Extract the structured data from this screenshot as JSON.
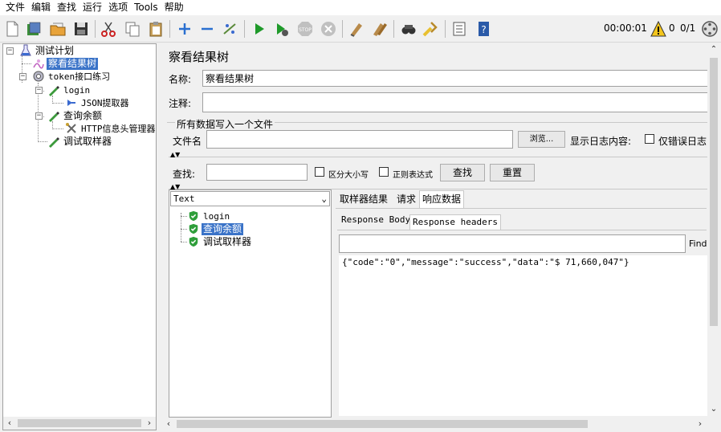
{
  "menu": [
    "文件",
    "编辑",
    "查找",
    "运行",
    "选项",
    "Tools",
    "帮助"
  ],
  "toolbar": {
    "timer": "00:00:01",
    "warnings": "0",
    "threads": "0/1",
    "icons": [
      "new-icon",
      "templates-icon",
      "open-icon",
      "save-icon",
      "cut-icon",
      "copy-icon",
      "paste-icon",
      "expand-icon",
      "collapse-icon",
      "toggle-icon",
      "start-icon",
      "start-no-pause-icon",
      "stop-icon",
      "shutdown-icon",
      "clear-icon",
      "clear-all-icon",
      "search-icon",
      "reset-search-icon",
      "function-helper-icon",
      "help-icon"
    ]
  },
  "tree": {
    "items": [
      {
        "label": "测试计划"
      },
      {
        "label": "察看结果树"
      },
      {
        "label": "token接口练习"
      },
      {
        "label": "login"
      },
      {
        "label": "JSON提取器"
      },
      {
        "label": "查询余额"
      },
      {
        "label": "HTTP信息头管理器"
      },
      {
        "label": "调试取样器"
      }
    ]
  },
  "panel": {
    "title": "察看结果树",
    "name_label": "名称:",
    "name_value": "察看结果树",
    "comment_label": "注释:",
    "comment_value": "",
    "file_group_label": "所有数据写入一个文件",
    "filename_label": "文件名",
    "filename_value": "",
    "browse_button": "浏览...",
    "log_display_label": "显示日志内容:",
    "errors_only_label": "仅错误日志"
  },
  "search": {
    "label": "查找:",
    "value": "",
    "case_sensitive": "区分大小写",
    "regex": "正则表达式",
    "search_button": "查找",
    "reset_button": "重置"
  },
  "results": {
    "renderer": "Text",
    "items": [
      {
        "label": "login",
        "status": "success"
      },
      {
        "label": "查询余额",
        "status": "success"
      },
      {
        "label": "调试取样器",
        "status": "success"
      }
    ]
  },
  "detail": {
    "tabs": [
      "取样器结果",
      "请求",
      "响应数据"
    ],
    "subtabs": [
      "Response Body",
      "Response headers"
    ],
    "find_value": "",
    "find_button": "Find",
    "body": "{\"code\":\"0\",\"message\":\"success\",\"data\":\"$ 71,660,047\"}"
  },
  "colors": {
    "selection": "#3a73c8",
    "success": "#2e9e3a"
  }
}
